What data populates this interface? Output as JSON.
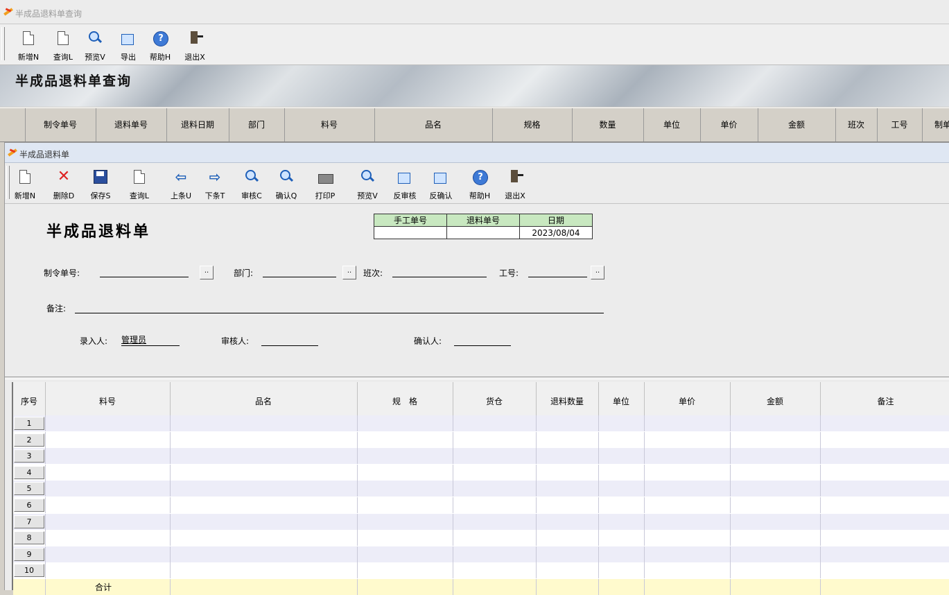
{
  "window": {
    "title": "半成品退料单查询"
  },
  "toolbar1": [
    {
      "label": "新增N",
      "icon": "new-doc-icon"
    },
    {
      "label": "查询L",
      "icon": "query-doc-icon"
    },
    {
      "label": "预览V",
      "icon": "magnifier-icon"
    },
    {
      "label": "导出",
      "icon": "export-icon"
    },
    {
      "label": "帮助H",
      "icon": "help-icon"
    },
    {
      "label": "退出X",
      "icon": "exit-door-icon"
    }
  ],
  "banner": {
    "title": "半成品退料单查询"
  },
  "list_columns": [
    "制令单号",
    "退料单号",
    "退料日期",
    "部门",
    "料号",
    "品名",
    "规格",
    "数量",
    "单位",
    "单价",
    "金额",
    "班次",
    "工号",
    "制单"
  ],
  "child": {
    "title": "半成品退料单",
    "toolbar": [
      {
        "label": "新增N",
        "icon": "new-doc-icon"
      },
      {
        "label": "删除D",
        "icon": "delete-x-icon"
      },
      {
        "label": "保存S",
        "icon": "save-disk-icon"
      },
      {
        "label": "查询L",
        "icon": "query-doc-icon"
      },
      {
        "label": "上条U",
        "icon": "arrow-left-icon"
      },
      {
        "label": "下条T",
        "icon": "arrow-right-icon"
      },
      {
        "label": "审核C",
        "icon": "magnifier-icon"
      },
      {
        "label": "确认Q",
        "icon": "magnifier-icon"
      },
      {
        "label": "打印P",
        "icon": "printer-icon"
      },
      {
        "label": "预览V",
        "icon": "magnifier-icon"
      },
      {
        "label": "反审核",
        "icon": "unaudit-icon"
      },
      {
        "label": "反确认",
        "icon": "unconfirm-icon"
      },
      {
        "label": "帮助H",
        "icon": "help-icon"
      },
      {
        "label": "退出X",
        "icon": "exit-door-icon"
      }
    ],
    "form_title": "半成品退料单",
    "mini_table": {
      "headers": [
        "手工单号",
        "退料单号",
        "日期"
      ],
      "values": [
        "",
        "",
        "2023/08/04"
      ]
    },
    "fields": {
      "order_no_label": "制令单号:",
      "dept_label": "部门:",
      "shift_label": "班次:",
      "worker_label": "工号:",
      "remark_label": "备注:",
      "entered_by_label": "录入人:",
      "entered_by_value": "管理员",
      "reviewer_label": "审核人:",
      "confirmer_label": "确认人:",
      "ellipsis": ".."
    },
    "grid": {
      "columns": [
        "序号",
        "料号",
        "品名",
        "规　格",
        "货仓",
        "退料数量",
        "单位",
        "单价",
        "金额",
        "备注"
      ],
      "rows": [
        "1",
        "2",
        "3",
        "4",
        "5",
        "6",
        "7",
        "8",
        "9",
        "10"
      ],
      "total_label": "合计"
    }
  },
  "colors": {
    "title_blue": "#dfe7f3",
    "mini_header": "#c8e8c0",
    "row_alt": "#ededf8",
    "total_row": "#fffacd"
  }
}
